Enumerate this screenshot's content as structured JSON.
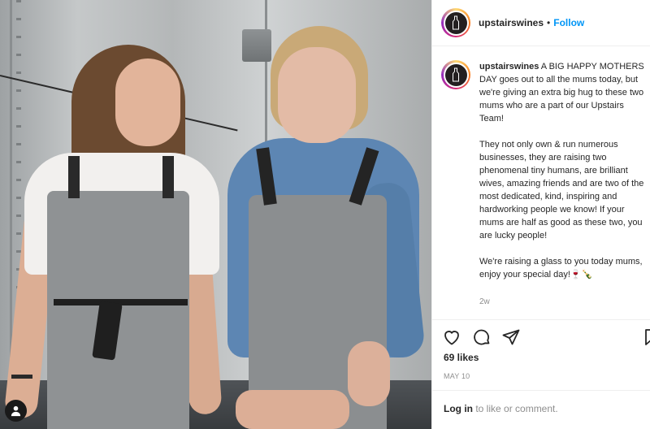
{
  "post": {
    "username": "upstairswines",
    "follow_separator": "•",
    "follow_label": "Follow",
    "caption_username": "upstairswines",
    "caption_text": " A BIG HAPPY MOTHERS DAY goes out to all the mums today, but we're giving an extra big hug to these two mums who are a part of our Upstairs Team!\n\nThey not only own & run numerous businesses, they are raising two phenomenal tiny humans, are brilliant wives, amazing friends and are two of the most dedicated, kind, inspiring and hardworking people we know! If your mums are half as good as these two, you are lucky people!\n\nWe're raising a glass to you today mums, enjoy your special day!🍷🍾",
    "age": "2w",
    "likes": "69 likes",
    "date": "MAY 10",
    "login_link": "Log in",
    "login_suffix": " to like or comment."
  },
  "icons": {
    "like": "heart-icon",
    "comment": "comment-icon",
    "share": "paper-plane-icon",
    "save": "bookmark-icon",
    "tag": "user-tag-icon",
    "avatar": "wine-bottle-logo"
  },
  "colors": {
    "follow": "#0095f6",
    "muted": "#8e8e8e",
    "text": "#262626"
  }
}
